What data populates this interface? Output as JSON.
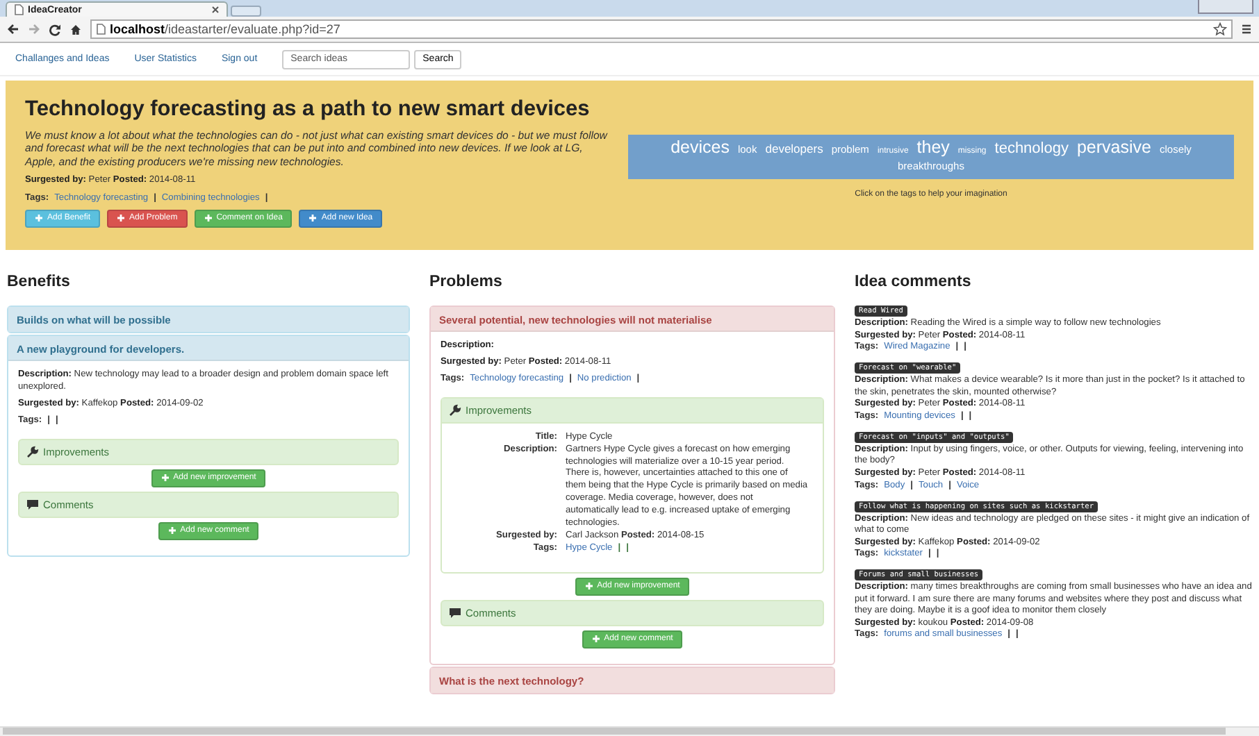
{
  "browser": {
    "tab_title": "IdeaCreator",
    "url": "**localhost**/ideastarter/evaluate.php?id=27"
  },
  "nav": {
    "links": [
      "Challanges and Ideas",
      "User Statistics",
      "Sign out"
    ],
    "search": {
      "placeholder": "Search ideas"
    },
    "search_button": "Search"
  },
  "idea": {
    "title": "Technology forecasting as a path to new smart devices",
    "description": "We must know a lot about what the technologies can do - not just what can existing smart devices do - but we must follow and forecast what will be the next technologies that can be put into and combined into new devices. If we look at LG, Apple, and the existing producers we're missing new technologies.",
    "meta": "**Surgested by:** Peter  **Posted:** 2014-08-11",
    "tags": {
      "label": "Tags:",
      "items": [
        {
          "kind": "link",
          "text": "Technology forecasting"
        },
        {
          "kind": "sep",
          "text": "|"
        },
        {
          "kind": "link",
          "text": "Combining technologies"
        },
        {
          "kind": "sep",
          "text": "|"
        }
      ]
    },
    "buttons": [
      {
        "label": "Add Benefit",
        "kind": "info"
      },
      {
        "label": "Add Problem",
        "kind": "danger"
      },
      {
        "label": "Comment on Idea",
        "kind": "success"
      },
      {
        "label": "Add new Idea",
        "kind": "primary"
      }
    ],
    "tag_cloud": {
      "words": [
        {
          "text": "devices",
          "kind": "xl"
        },
        {
          "text": "look",
          "kind": "s"
        },
        {
          "text": "developers",
          "kind": "m"
        },
        {
          "text": "problem",
          "kind": "s"
        },
        {
          "text": "intrusive",
          "kind": "xs"
        },
        {
          "text": "they",
          "kind": "xl"
        },
        {
          "text": "missing",
          "kind": "xs"
        },
        {
          "text": "technology",
          "kind": "l"
        },
        {
          "text": "pervasive",
          "kind": "xl"
        },
        {
          "text": "closely",
          "kind": "s"
        },
        {
          "text": "breakthroughs",
          "kind": "s"
        }
      ],
      "hint": "Click on the tags to help your imagination"
    }
  },
  "benefits": {
    "heading": "Benefits",
    "items": [
      {
        "title": "Builds on what will be possible",
        "expanded": false
      },
      {
        "title": "A new playground for developers.",
        "expanded": true,
        "description": "**Description:** New technology may lead to a broader design and problem domain space left unexplored.",
        "meta": "**Surgested by:** Kaffekop  **Posted:** 2014-09-02",
        "tags": {
          "label": "Tags:",
          "items": [
            {
              "kind": "sep",
              "text": "|"
            },
            {
              "kind": "sep",
              "text": "|"
            }
          ]
        },
        "improvements": {
          "heading": "Improvements",
          "button": "Add new improvement"
        },
        "comments": {
          "heading": "Comments",
          "button": "Add new comment"
        }
      }
    ]
  },
  "problems": {
    "heading": "Problems",
    "items": [
      {
        "title": "Several potential, new technologies will not materialise",
        "expanded": true,
        "description": "**Description:**",
        "meta": "**Surgested by:** Peter  **Posted:** 2014-08-11",
        "tags": {
          "label": "Tags:",
          "items": [
            {
              "kind": "link",
              "text": "Technology forecasting"
            },
            {
              "kind": "sep",
              "text": "|"
            },
            {
              "kind": "link",
              "text": "No prediction"
            },
            {
              "kind": "sep",
              "text": "|"
            }
          ]
        },
        "improvements": {
          "heading": "Improvements",
          "entries": [
            {
              "rows": [
                {
                  "label": "Title:",
                  "value": "Hype Cycle"
                },
                {
                  "label": "Description:",
                  "value": "Gartners Hype Cycle gives a forecast on how emerging technologies will materialize over a 10-15 year period. There is, however, uncertainties attached to this one of them being that the Hype Cycle is primarily based on media coverage. Media coverage, however, does not automatically lead to e.g. increased uptake of emerging technologies."
                },
                {
                  "label": "Surgested by:",
                  "value": "Carl Jackson  **Posted:** 2014-08-15"
                },
                {
                  "label": "Tags:",
                  "tags": [
                    {
                      "kind": "link",
                      "text": "Hype Cycle"
                    },
                    {
                      "kind": "sep",
                      "text": "|"
                    },
                    {
                      "kind": "sep",
                      "text": "|"
                    }
                  ]
                }
              ]
            }
          ],
          "button": "Add new improvement"
        },
        "comments": {
          "heading": "Comments",
          "button": "Add new comment"
        }
      },
      {
        "title": "What is the next technology?",
        "expanded": false
      }
    ]
  },
  "idea_comments": {
    "heading": "Idea comments",
    "items": [
      {
        "title": "Read Wired",
        "description": "**Description:** Reading the Wired is a simple way to follow new technologies",
        "meta": "**Surgested by:** Peter  **Posted:** 2014-08-11",
        "tags": {
          "label": "Tags:",
          "items": [
            {
              "kind": "link",
              "text": "Wired Magazine"
            },
            {
              "kind": "sep",
              "text": "|"
            },
            {
              "kind": "sep",
              "text": "|"
            }
          ]
        }
      },
      {
        "title": "Forecast on \"wearable\"",
        "description": "**Description:** What makes a device wearable? Is it more than just in the pocket? Is it attached to the skin, penetrates the skin, mounted otherwise?",
        "meta": "**Surgested by:** Peter  **Posted:** 2014-08-11",
        "tags": {
          "label": "Tags:",
          "items": [
            {
              "kind": "link",
              "text": "Mounting devices"
            },
            {
              "kind": "sep",
              "text": "|"
            },
            {
              "kind": "sep",
              "text": "|"
            }
          ]
        }
      },
      {
        "title": "Forecast on \"inputs\" and \"outputs\"",
        "description": "**Description:** Input by using fingers, voice, or other. Outputs for viewing, feeling, intervening into the body?",
        "meta": "**Surgested by:** Peter  **Posted:** 2014-08-11",
        "tags": {
          "label": "Tags:",
          "items": [
            {
              "kind": "link",
              "text": "Body"
            },
            {
              "kind": "sep",
              "text": "|"
            },
            {
              "kind": "link",
              "text": "Touch"
            },
            {
              "kind": "sep",
              "text": "|"
            },
            {
              "kind": "link",
              "text": "Voice"
            }
          ]
        }
      },
      {
        "title": "Follow what is happening on sites such as kickstarter",
        "description": "**Description:** New ideas and technology are pledged on these sites - it might give an indication of what to come",
        "meta": "**Surgested by:** Kaffekop  **Posted:** 2014-09-02",
        "tags": {
          "label": "Tags:",
          "items": [
            {
              "kind": "link",
              "text": "kickstater"
            },
            {
              "kind": "sep",
              "text": "|"
            },
            {
              "kind": "sep",
              "text": "|"
            }
          ]
        }
      },
      {
        "title": "Forums and small businesses",
        "description": "**Description:** many times breakthroughs are coming from small businesses who have an idea and put it forward. I am sure there are many forums and websites where they post and discuss what they are doing. Maybe it is a goof idea to monitor them closely",
        "meta": "**Surgested by:** koukou  **Posted:** 2014-09-08",
        "tags": {
          "label": "Tags:",
          "items": [
            {
              "kind": "link",
              "text": "forums and small businesses"
            },
            {
              "kind": "sep",
              "text": "|"
            },
            {
              "kind": "sep",
              "text": "|"
            }
          ]
        }
      }
    ]
  }
}
